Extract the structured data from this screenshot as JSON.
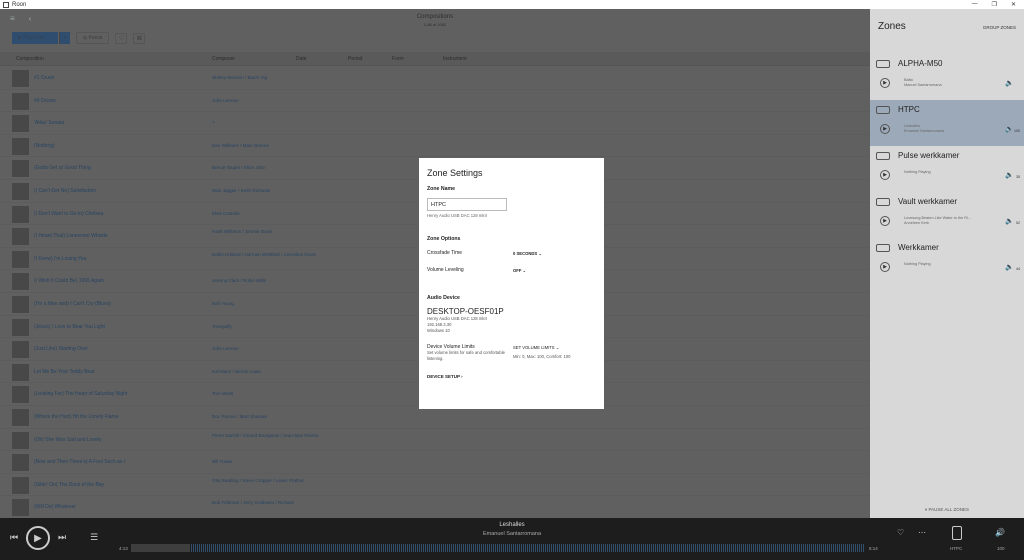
{
  "window": {
    "title": "Roon",
    "controls": [
      "—",
      "❐",
      "✕"
    ]
  },
  "header": {
    "nav_menu": "≡",
    "nav_back": "‹",
    "title": "Compositions",
    "subtitle": "1-86 of 1062"
  },
  "toolbar": {
    "play_label": "▶ Play Now",
    "play_drop": "▾",
    "focus_label": "◎ Focus",
    "heart": "♡",
    "tag": "⌘"
  },
  "columns": {
    "composition": "Composition",
    "composer": "Composer",
    "date": "Date",
    "period": "Period",
    "form": "Form",
    "instrument": "Instrument"
  },
  "rows": [
    {
      "title": "#1 Crush",
      "composer": "Shirley Manson / Butch Vig"
    },
    {
      "title": "#9 Dream",
      "composer": "John Lennon"
    },
    {
      "title": "'Atlas' Sonata",
      "composer": "?"
    },
    {
      "title": "(Nothing)",
      "composer": "Dee Williams / Marc Barnes"
    },
    {
      "title": "(Gotta Get a) Good Thing",
      "composer": "Bernie Taupin / Elton John"
    },
    {
      "title": "(I Can't Get No) Satisfaction",
      "composer": "Mick Jagger / Keith Richards"
    },
    {
      "title": "(I Don't Want to Go to) Chelsea",
      "composer": "Elvis Costello"
    },
    {
      "title": "(I Heard That) Lonesome Whistle",
      "composer": "Hank Williams / Jimmie Davis",
      "two": true
    },
    {
      "title": "(I Know) I'm Losing You",
      "composer": "Eddie Holland / Norman Whitfield / Cornelius Grant",
      "two": true
    },
    {
      "title": "(I Wish It Could Be) 1965 Again",
      "composer": "Jeremy Clark / Robin Wills"
    },
    {
      "title": "(I'm a Man and) I Can't Cry (Blues)",
      "composer": "Neil Young"
    },
    {
      "title": "(Jesus) I Love to Bear You Light",
      "composer": "Tonegaffy"
    },
    {
      "title": "(Just Like) Starting Over",
      "composer": "John Lennon"
    },
    {
      "title": "Let Me Be Your Teddy Bear",
      "composer": "Kal Mann / Bernie Lowe"
    },
    {
      "title": "(Looking For) The Heart of Saturday Night",
      "composer": "Tom Waits"
    },
    {
      "title": "(Where the Hurt) Hit the Lonely Flame",
      "composer": "Doc Pomus / Mort Shuman"
    },
    {
      "title": "(Oh) She Was Sad and Lonely",
      "composer": "Pierre Darrell / Gérard Bourgeois / Jean-Max Rivière",
      "two": true
    },
    {
      "title": "(Now and Then There's) A Fool Such as I",
      "composer": "Bill Trader"
    },
    {
      "title": "(Sittin' On) The Dock of the Bay",
      "composer": "Otis Redding / Steve Cropper / Lewis Prather",
      "two": true
    },
    {
      "title": "(Will Do) Whatever",
      "composer": "Bob Feldman / Jerry Goldstein / Richard",
      "two": true
    }
  ],
  "modal": {
    "title": "Zone Settings",
    "zone_name_heading": "Zone Name",
    "zone_name_value": "HTPC",
    "zone_name_hint": "Henry Audio USB DAC 128 mkII",
    "options_heading": "Zone Options",
    "crossfade_label": "Crossfade Time",
    "crossfade_value": "0 SECONDS ⌄",
    "leveling_label": "Volume Leveling",
    "leveling_value": "OFF ⌄",
    "audio_heading": "Audio Device",
    "device_name": "DESKTOP-OESF01P",
    "device_line1": "Henry Audio USB DAC 128 mkII",
    "device_line2": "192.168.3.30",
    "device_line3": "Windows 10",
    "limits_label": "Device Volume Limits",
    "limits_hint": "Set volume limits for safe and comfortable listening.",
    "limits_action": "SET VOLUME LIMITS ⌄",
    "limits_values": "Min: 0, Max: 100, Comfort: 100",
    "device_setup": "DEVICE SETUP ›"
  },
  "zones": {
    "heading": "Zones",
    "group_label": "GROUP ZONES",
    "pause_all": "⏸ PAUSE ALL ZONES",
    "items": [
      {
        "name": "ALPHA-M50",
        "track": "Baltic\nManuel Santarromana",
        "vol": "🔈",
        "num": ""
      },
      {
        "name": "HTPC",
        "track": "Leshalles\nEmanuel Santarromana",
        "vol": "🔈",
        "num": "100",
        "active": true
      },
      {
        "name": "Pulse werkkamer",
        "track": "Nothing Playing",
        "vol": "🔈",
        "num": "35"
      },
      {
        "name": "Vault werkkamer",
        "track": "Lovesong Beaten Like Water to the Ri...\nAnneleen Kerk",
        "vol": "🔈",
        "num": "52"
      },
      {
        "name": "Werkkamer",
        "track": "Nothing Playing",
        "vol": "🔈",
        "num": "44"
      }
    ]
  },
  "player": {
    "track": "Leshalles",
    "artist": "Emanuel Santarromana",
    "elapsed": "4:13",
    "duration": "5:14",
    "progress": 0.08,
    "prev": "⏮",
    "play": "▶",
    "next": "⏭",
    "queue": "☰",
    "heart": "♡",
    "more": "⋯",
    "zone_label": "HTPC",
    "volume": "100",
    "volume_icon": "🔊"
  }
}
